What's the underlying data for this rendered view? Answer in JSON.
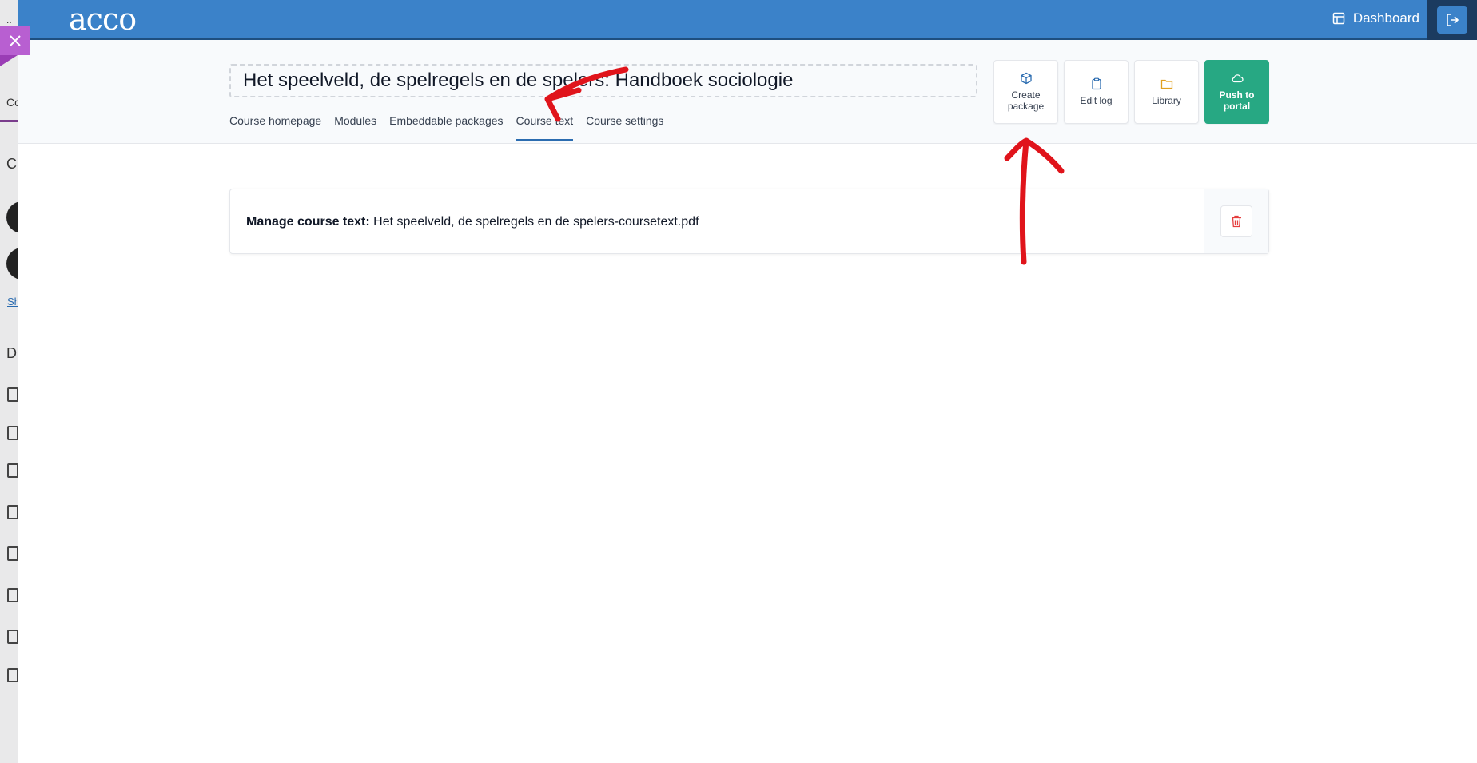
{
  "underlying": {
    "fragments": [
      "Co",
      "C",
      "D"
    ],
    "link": "Sh"
  },
  "topbar": {
    "logo": "acco",
    "dashboard_label": "Dashboard"
  },
  "course": {
    "title": "Het speelveld, de spelregels en de spelers: Handboek sociologie"
  },
  "tabs": [
    {
      "label": "Course homepage"
    },
    {
      "label": "Modules"
    },
    {
      "label": "Embeddable packages"
    },
    {
      "label": "Course text"
    },
    {
      "label": "Course settings"
    }
  ],
  "actions": {
    "create_package": "Create package",
    "edit_log": "Edit log",
    "library": "Library",
    "push_to_portal": "Push to portal"
  },
  "course_text": {
    "label": "Manage course text:",
    "filename": "Het speelveld, de spelregels en de spelers-coursetext.pdf"
  },
  "colors": {
    "topbar": "#3b82c9",
    "push_button": "#27a883",
    "delete_icon": "#e53e3e",
    "annotation": "#e0141b"
  }
}
